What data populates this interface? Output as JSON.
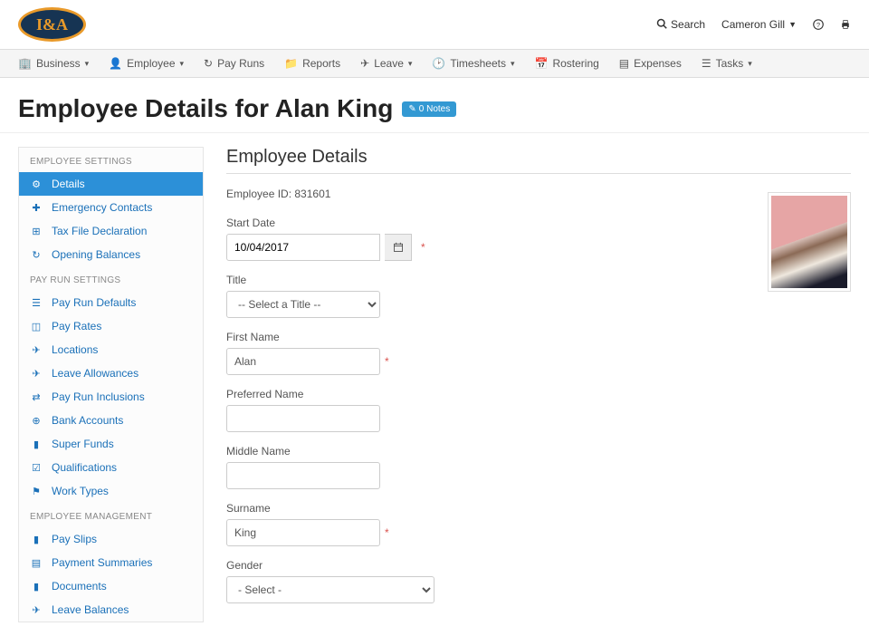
{
  "topbar": {
    "search": "Search",
    "user": "Cameron Gill"
  },
  "nav": [
    {
      "label": "Business",
      "caret": true
    },
    {
      "label": "Employee",
      "caret": true
    },
    {
      "label": "Pay Runs",
      "caret": false
    },
    {
      "label": "Reports",
      "caret": false
    },
    {
      "label": "Leave",
      "caret": true
    },
    {
      "label": "Timesheets",
      "caret": true
    },
    {
      "label": "Rostering",
      "caret": false
    },
    {
      "label": "Expenses",
      "caret": false
    },
    {
      "label": "Tasks",
      "caret": true
    }
  ],
  "page": {
    "title": "Employee Details for Alan King",
    "notes_badge": "0 Notes"
  },
  "sidebar": {
    "groups": [
      {
        "heading": "EMPLOYEE SETTINGS",
        "items": [
          {
            "icon": "⚙",
            "label": "Details",
            "active": true
          },
          {
            "icon": "✚",
            "label": "Emergency Contacts"
          },
          {
            "icon": "⊞",
            "label": "Tax File Declaration"
          },
          {
            "icon": "↻",
            "label": "Opening Balances"
          }
        ]
      },
      {
        "heading": "PAY RUN SETTINGS",
        "items": [
          {
            "icon": "☰",
            "label": "Pay Run Defaults"
          },
          {
            "icon": "◫",
            "label": "Pay Rates"
          },
          {
            "icon": "✈",
            "label": "Locations"
          },
          {
            "icon": "✈",
            "label": "Leave Allowances"
          },
          {
            "icon": "⇄",
            "label": "Pay Run Inclusions"
          },
          {
            "icon": "⊕",
            "label": "Bank Accounts"
          },
          {
            "icon": "▮",
            "label": "Super Funds"
          },
          {
            "icon": "☑",
            "label": "Qualifications"
          },
          {
            "icon": "⚑",
            "label": "Work Types"
          }
        ]
      },
      {
        "heading": "EMPLOYEE MANAGEMENT",
        "items": [
          {
            "icon": "▮",
            "label": "Pay Slips"
          },
          {
            "icon": "▤",
            "label": "Payment Summaries"
          },
          {
            "icon": "▮",
            "label": "Documents"
          },
          {
            "icon": "✈",
            "label": "Leave Balances"
          }
        ]
      }
    ]
  },
  "details": {
    "section_title": "Employee Details",
    "employee_id_label": "Employee ID:",
    "employee_id": "831601",
    "fields": {
      "start_date": {
        "label": "Start Date",
        "value": "10/04/2017"
      },
      "title": {
        "label": "Title",
        "placeholder": "-- Select a Title --"
      },
      "first_name": {
        "label": "First Name",
        "value": "Alan"
      },
      "preferred_name": {
        "label": "Preferred Name",
        "value": ""
      },
      "middle_name": {
        "label": "Middle Name",
        "value": ""
      },
      "surname": {
        "label": "Surname",
        "value": "King"
      },
      "gender": {
        "label": "Gender",
        "placeholder": "- Select -"
      }
    }
  }
}
